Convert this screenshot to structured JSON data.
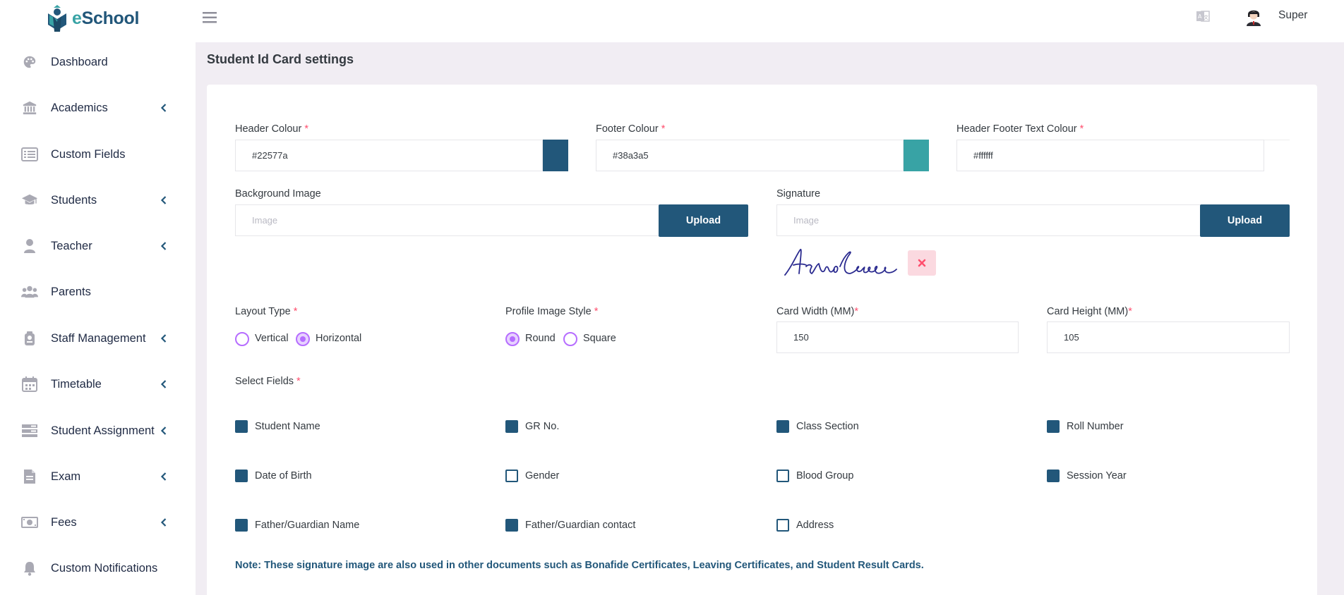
{
  "app": {
    "logo_text_e": "e",
    "logo_text_rest": "School"
  },
  "sidebar": {
    "items": [
      {
        "label": "Dashboard",
        "icon": "palette-icon",
        "expandable": false
      },
      {
        "label": "Academics",
        "icon": "bank-icon",
        "expandable": true
      },
      {
        "label": "Custom Fields",
        "icon": "list-icon",
        "expandable": false
      },
      {
        "label": "Students",
        "icon": "graduation-cap-icon",
        "expandable": true
      },
      {
        "label": "Teacher",
        "icon": "user-icon",
        "expandable": true
      },
      {
        "label": "Parents",
        "icon": "users-icon",
        "expandable": false
      },
      {
        "label": "Staff Management",
        "icon": "staff-icon",
        "expandable": true
      },
      {
        "label": "Timetable",
        "icon": "calendar-icon",
        "expandable": true
      },
      {
        "label": "Student Assignment",
        "icon": "tasks-icon",
        "expandable": true
      },
      {
        "label": "Exam",
        "icon": "file-icon",
        "expandable": true
      },
      {
        "label": "Fees",
        "icon": "money-icon",
        "expandable": true
      },
      {
        "label": "Custom Notifications",
        "icon": "bell-icon",
        "expandable": false
      }
    ]
  },
  "topbar": {
    "user_name": "Super"
  },
  "page": {
    "title": "Student Id Card settings"
  },
  "form": {
    "header_colour": {
      "label": "Header Colour",
      "required": "*",
      "value": "#22577a",
      "swatch": "#22577a"
    },
    "footer_colour": {
      "label": "Footer Colour",
      "required": "*",
      "value": "#38a3a5",
      "swatch": "#38a3a5"
    },
    "text_colour": {
      "label": "Header Footer Text Colour",
      "required": "*",
      "value": "#ffffff",
      "swatch": "#ffffff"
    },
    "background_image": {
      "label": "Background Image",
      "placeholder": "Image",
      "button": "Upload"
    },
    "signature": {
      "label": "Signature",
      "placeholder": "Image",
      "button": "Upload"
    },
    "layout_type": {
      "label": "Layout Type",
      "required": "*",
      "options": [
        "Vertical",
        "Horizontal"
      ],
      "selected": "Horizontal"
    },
    "profile_image_style": {
      "label": "Profile Image Style",
      "required": "*",
      "options": [
        "Round",
        "Square"
      ],
      "selected": "Round"
    },
    "card_width": {
      "label": "Card Width (MM)",
      "required": "*",
      "value": "150"
    },
    "card_height": {
      "label": "Card Height (MM)",
      "required": "*",
      "value": "105"
    },
    "select_fields": {
      "label": "Select Fields",
      "required": "*",
      "fields": [
        {
          "label": "Student Name",
          "checked": true
        },
        {
          "label": "GR No.",
          "checked": true
        },
        {
          "label": "Class Section",
          "checked": true
        },
        {
          "label": "Roll Number",
          "checked": true
        },
        {
          "label": "Date of Birth",
          "checked": true
        },
        {
          "label": "Gender",
          "checked": false
        },
        {
          "label": "Blood Group",
          "checked": false
        },
        {
          "label": "Session Year",
          "checked": true
        },
        {
          "label": "Father/Guardian Name",
          "checked": true
        },
        {
          "label": "Father/Guardian contact",
          "checked": true
        },
        {
          "label": "Address",
          "checked": false
        }
      ]
    },
    "note": "Note: These signature image are also used in other documents such as Bonafide Certificates, Leaving Certificates, and Student Result Cards."
  },
  "colors": {
    "primary": "#22577a",
    "teal": "#38a3a5",
    "accent_purple": "#b66dff",
    "required_red": "#ff4f6e",
    "background": "#f1edf3"
  }
}
